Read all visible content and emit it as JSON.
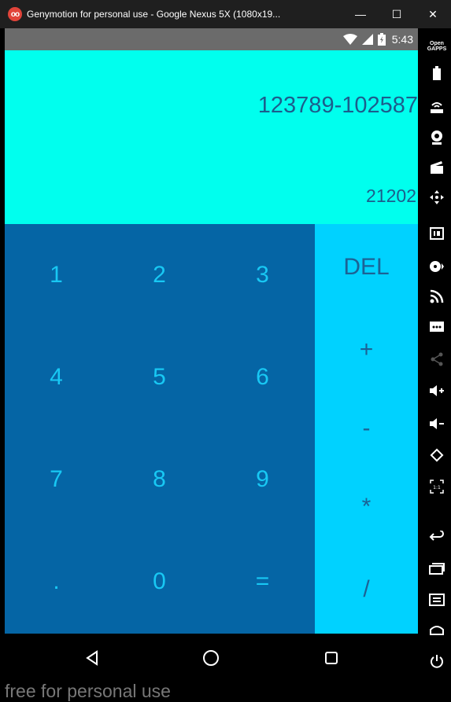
{
  "window": {
    "title": "Genymotion for personal use - Google Nexus 5X (1080x19...",
    "logo_text": "oo",
    "minimize": "—",
    "maximize": "☐",
    "close": "✕"
  },
  "status_bar": {
    "time": "5:43"
  },
  "display": {
    "expression": "123789-102587",
    "result": "21202"
  },
  "keys": {
    "k1": "1",
    "k2": "2",
    "k3": "3",
    "k4": "4",
    "k5": "5",
    "k6": "6",
    "k7": "7",
    "k8": "8",
    "k9": "9",
    "dot": ".",
    "k0": "0",
    "equals": "="
  },
  "operators": {
    "del": "DEL",
    "plus": "+",
    "minus": "-",
    "multiply": "*",
    "divide": "/"
  },
  "watermark": "free for personal use",
  "toolbar": {
    "opengapps_line1": "Open",
    "opengapps_line2": "GAPPS"
  },
  "colors": {
    "display_bg": "#00ffee",
    "numpad_bg": "#0565a5",
    "operator_bg": "#00d2ff",
    "digit_text": "#18c8f4",
    "operator_text": "#1c6295"
  }
}
